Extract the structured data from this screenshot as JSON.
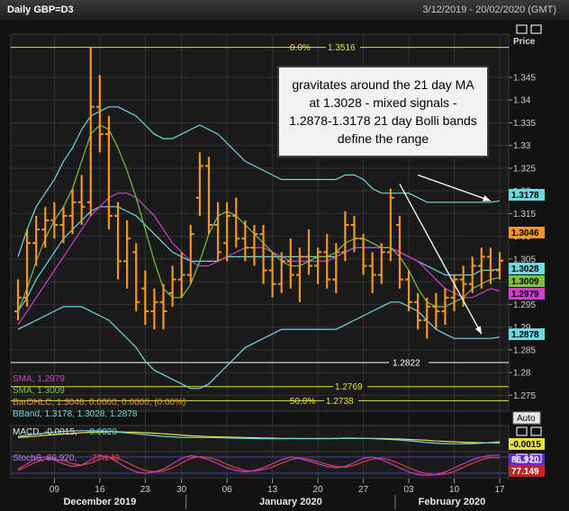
{
  "window": {
    "title": "Daily GBP=D3",
    "date_range": "3/12/2019 - 20/02/2020 (GMT)",
    "price_label": "Price",
    "auto_button": "Auto"
  },
  "annotation": {
    "text": "gravitates around the 21 day MA at 1.3028 - mixed signals - 1.2878-1.3178 21 day Bolli bands define the range"
  },
  "colors": {
    "price_bar": "#f0962a",
    "sma_magenta": "#d040d0",
    "sma_green": "#80c040",
    "bband": "#70d8e0",
    "fib_line": "#e8e040",
    "macd_line": "#70d8e0",
    "macd_signal": "#e8e040",
    "stoch_k": "#c040c0",
    "stoch_d": "#e04040",
    "grid": "#333333"
  },
  "chart_data": {
    "type": "ohlc",
    "y_axis_ticks": [
      1.275,
      1.28,
      1.285,
      1.29,
      1.295,
      1.3,
      1.305,
      1.31,
      1.315,
      1.32,
      1.325,
      1.33,
      1.335,
      1.34,
      1.345
    ],
    "ylim": [
      1.2715,
      1.3545
    ],
    "x_ticks": [
      "09",
      "16",
      "23",
      "30",
      "06",
      "13",
      "20",
      "27",
      "03",
      "10",
      "17"
    ],
    "x_tick_index": [
      4,
      9,
      14,
      18,
      23,
      28,
      33,
      38,
      43,
      48,
      53
    ],
    "months": [
      {
        "label": "December 2019",
        "start": 0,
        "end": 19
      },
      {
        "label": "January 2020",
        "start": 19,
        "end": 42
      },
      {
        "label": "February 2020",
        "start": 42,
        "end": 54
      }
    ],
    "bars": [
      [
        1.2935,
        1.3005,
        1.2915,
        1.2965
      ],
      [
        1.2965,
        1.3115,
        1.2945,
        1.3085
      ],
      [
        1.3085,
        1.3145,
        1.3035,
        1.3115
      ],
      [
        1.3115,
        1.3165,
        1.3075,
        1.3135
      ],
      [
        1.3135,
        1.3175,
        1.3095,
        1.3125
      ],
      [
        1.3125,
        1.3165,
        1.3085,
        1.3145
      ],
      [
        1.3145,
        1.3205,
        1.3105,
        1.3175
      ],
      [
        1.3175,
        1.3235,
        1.3125,
        1.3165
      ],
      [
        1.3175,
        1.3515,
        1.3145,
        1.3385
      ],
      [
        1.3385,
        1.3455,
        1.3285,
        1.3325
      ],
      [
        1.3325,
        1.3365,
        1.3115,
        1.3145
      ],
      [
        1.3145,
        1.3175,
        1.3005,
        1.3045
      ],
      [
        1.3045,
        1.3135,
        1.2985,
        1.3095
      ],
      [
        1.3065,
        1.3085,
        1.2935,
        1.2955
      ],
      [
        1.2985,
        1.3025,
        1.2905,
        1.2935
      ],
      [
        1.2935,
        1.2985,
        1.2895,
        1.2955
      ],
      [
        1.2955,
        1.2995,
        1.2895,
        1.2935
      ],
      [
        1.2975,
        1.3035,
        1.2945,
        1.3005
      ],
      [
        1.3005,
        1.3065,
        1.2965,
        1.3015
      ],
      [
        1.3015,
        1.3125,
        1.2995,
        1.3105
      ],
      [
        1.3185,
        1.3285,
        1.3145,
        1.3255
      ],
      [
        1.3255,
        1.3275,
        1.3105,
        1.3125
      ],
      [
        1.3125,
        1.3175,
        1.3045,
        1.3065
      ],
      [
        1.3085,
        1.3175,
        1.3045,
        1.3145
      ],
      [
        1.3145,
        1.3185,
        1.3075,
        1.3095
      ],
      [
        1.3095,
        1.3135,
        1.3045,
        1.3075
      ],
      [
        1.3075,
        1.3125,
        1.3035,
        1.3105
      ],
      [
        1.3105,
        1.3125,
        1.2995,
        1.3025
      ],
      [
        1.3025,
        1.3065,
        1.2965,
        1.2995
      ],
      [
        1.2995,
        1.3065,
        1.2975,
        1.3045
      ],
      [
        1.3045,
        1.3095,
        1.2985,
        1.3015
      ],
      [
        1.3015,
        1.3075,
        1.2955,
        1.3055
      ],
      [
        1.3055,
        1.3115,
        1.3015,
        1.3035
      ],
      [
        1.3035,
        1.3075,
        1.2995,
        1.3065
      ],
      [
        1.3065,
        1.3105,
        1.2985,
        1.3005
      ],
      [
        1.3005,
        1.3085,
        1.2975,
        1.3065
      ],
      [
        1.3065,
        1.3155,
        1.3045,
        1.3125
      ],
      [
        1.3125,
        1.3145,
        1.3065,
        1.3095
      ],
      [
        1.3095,
        1.3105,
        1.3015,
        1.3035
      ],
      [
        1.3035,
        1.3065,
        1.2975,
        1.3015
      ],
      [
        1.3015,
        1.3085,
        1.2995,
        1.3065
      ],
      [
        1.3065,
        1.3205,
        1.3045,
        1.3185
      ],
      [
        1.3125,
        1.3145,
        1.2985,
        1.3005
      ],
      [
        1.3005,
        1.3025,
        1.2935,
        1.2955
      ],
      [
        1.2955,
        1.2975,
        1.2895,
        1.2915
      ],
      [
        1.2915,
        1.2965,
        1.2875,
        1.2945
      ],
      [
        1.2945,
        1.2975,
        1.2895,
        1.2935
      ],
      [
        1.2935,
        1.2985,
        1.2905,
        1.2965
      ],
      [
        1.2965,
        1.3015,
        1.2935,
        1.3005
      ],
      [
        1.3005,
        1.3035,
        1.2945,
        1.2995
      ],
      [
        1.2995,
        1.3055,
        1.2975,
        1.3035
      ],
      [
        1.3035,
        1.3075,
        1.2985,
        1.3055
      ],
      [
        1.3055,
        1.3075,
        1.2995,
        1.3025
      ],
      [
        1.3025,
        1.3065,
        1.3005,
        1.3046
      ]
    ],
    "sma_magenta": [
      1.2905,
      1.2935,
      1.2965,
      1.2995,
      1.3025,
      1.3055,
      1.3085,
      1.3115,
      1.3145,
      1.3165,
      1.3185,
      1.3195,
      1.3195,
      1.3185,
      1.3165,
      1.3145,
      1.3115,
      1.3085,
      1.3065,
      1.3045,
      1.3035,
      1.3035,
      1.3045,
      1.3055,
      1.3065,
      1.3075,
      1.3075,
      1.3075,
      1.3065,
      1.3055,
      1.3045,
      1.3045,
      1.3045,
      1.3045,
      1.3045,
      1.3055,
      1.3065,
      1.3075,
      1.3075,
      1.3075,
      1.3075,
      1.3075,
      1.3065,
      1.3055,
      1.3045,
      1.3025,
      1.3005,
      1.2985,
      1.2975,
      1.2965,
      1.2965,
      1.2975,
      1.2985,
      1.2979
    ],
    "sma_green": [
      1.2935,
      1.2985,
      1.3045,
      1.3095,
      1.3135,
      1.3165,
      1.3205,
      1.3265,
      1.3325,
      1.3345,
      1.3335,
      1.3295,
      1.3245,
      1.3185,
      1.3115,
      1.3045,
      1.2985,
      1.2965,
      1.2965,
      1.2995,
      1.3045,
      1.3105,
      1.3145,
      1.3155,
      1.3145,
      1.3125,
      1.3105,
      1.3085,
      1.3065,
      1.3045,
      1.3035,
      1.3035,
      1.3045,
      1.3055,
      1.3055,
      1.3065,
      1.3085,
      1.3095,
      1.3095,
      1.3085,
      1.3075,
      1.3075,
      1.3055,
      1.3025,
      1.2985,
      1.2955,
      1.2945,
      1.2945,
      1.2955,
      1.2965,
      1.2985,
      1.2995,
      1.3005,
      1.3009
    ],
    "bb_upper": [
      1.3055,
      1.3115,
      1.3165,
      1.3195,
      1.3225,
      1.3265,
      1.3295,
      1.3335,
      1.3365,
      1.3375,
      1.3385,
      1.3385,
      1.3375,
      1.3365,
      1.3345,
      1.3325,
      1.3315,
      1.3315,
      1.3325,
      1.3335,
      1.3345,
      1.3335,
      1.3325,
      1.3305,
      1.3285,
      1.3265,
      1.3255,
      1.3245,
      1.3235,
      1.3225,
      1.3225,
      1.3225,
      1.3225,
      1.3225,
      1.3225,
      1.3225,
      1.3235,
      1.3235,
      1.3225,
      1.3205,
      1.3195,
      1.3195,
      1.3195,
      1.3195,
      1.3185,
      1.3175,
      1.3175,
      1.3175,
      1.3175,
      1.3175,
      1.3175,
      1.3175,
      1.3175,
      1.3178
    ],
    "bb_mid": [
      1.2935,
      1.2965,
      1.3005,
      1.3035,
      1.3065,
      1.3095,
      1.3115,
      1.3135,
      1.3155,
      1.3165,
      1.3165,
      1.3165,
      1.3155,
      1.3145,
      1.3125,
      1.3105,
      1.3085,
      1.3065,
      1.3055,
      1.3045,
      1.3045,
      1.3045,
      1.3045,
      1.3055,
      1.3055,
      1.3055,
      1.3055,
      1.3055,
      1.3055,
      1.3055,
      1.3055,
      1.3055,
      1.3055,
      1.3055,
      1.3055,
      1.3055,
      1.3065,
      1.3075,
      1.3075,
      1.3075,
      1.3075,
      1.3075,
      1.3065,
      1.3055,
      1.3045,
      1.3035,
      1.3025,
      1.3015,
      1.3015,
      1.3015,
      1.3015,
      1.3025,
      1.3025,
      1.3028
    ],
    "bb_lower": [
      1.2895,
      1.2905,
      1.2915,
      1.2925,
      1.2935,
      1.2945,
      1.2945,
      1.2945,
      1.2935,
      1.2925,
      1.2915,
      1.2895,
      1.2875,
      1.2855,
      1.2825,
      1.2805,
      1.2795,
      1.2785,
      1.2775,
      1.2765,
      1.2765,
      1.2775,
      1.2795,
      1.2815,
      1.2835,
      1.2855,
      1.2865,
      1.2875,
      1.2885,
      1.2895,
      1.2895,
      1.2895,
      1.2895,
      1.2895,
      1.2895,
      1.2895,
      1.2905,
      1.2915,
      1.2925,
      1.2935,
      1.2945,
      1.2955,
      1.2955,
      1.2945,
      1.2935,
      1.2915,
      1.2895,
      1.2885,
      1.2875,
      1.2875,
      1.2875,
      1.2875,
      1.2875,
      1.2878
    ],
    "fib_lines": [
      {
        "value": 1.3516,
        "label": "0.0%",
        "value_text": "1.3516"
      },
      {
        "value": 1.2769,
        "label": "",
        "value_text": "1.2769"
      },
      {
        "value": 1.2738,
        "label": "50.0%",
        "value_text": "1.2738"
      }
    ],
    "level_lines": [
      {
        "value": 1.2822,
        "value_text": "1.2822"
      }
    ],
    "price_tags": [
      {
        "value": 1.3178,
        "text": "1.3178",
        "color": "#70d8e0"
      },
      {
        "value": 1.3046,
        "text": "1.3046",
        "color": "#f0962a"
      },
      {
        "value": 1.3028,
        "text": "1.3028",
        "color": "#70d8e0"
      },
      {
        "value": 1.3009,
        "text": "1.3009",
        "color": "#80c040"
      },
      {
        "value": 1.2979,
        "text": "1.2979",
        "color": "#d040d0"
      },
      {
        "value": 1.2878,
        "text": "1.2878",
        "color": "#70d8e0"
      }
    ],
    "arrows": [
      {
        "from": [
          44,
          1.3235
        ],
        "to": [
          52,
          1.3178
        ]
      },
      {
        "from": [
          42,
          1.3215
        ],
        "to": [
          51,
          1.2885
        ]
      }
    ],
    "legend": [
      {
        "text": "SMA, 1.2979",
        "color": "#d040d0"
      },
      {
        "text": "SMA, 1.3009",
        "color": "#80c040"
      },
      {
        "text": "BarOHLC, 1.3046, 0.0000, 0.0000, (0.00%)",
        "color": "#f0962a"
      },
      {
        "text": "BBand, 1.3178, 1.3028, 1.2878",
        "color": "#70d8e0"
      }
    ],
    "macd": {
      "legend_name": "MACD, -0.0015, ",
      "legend_value": "-0.0020",
      "last": -0.0015,
      "last_text": "-0.0015",
      "ylim": [
        -0.006,
        0.006
      ],
      "macd": [
        0.001,
        0.0015,
        0.002,
        0.0025,
        0.003,
        0.0033,
        0.0035,
        0.0036,
        0.0036,
        0.0035,
        0.0033,
        0.003,
        0.0026,
        0.0022,
        0.0018,
        0.0014,
        0.001,
        0.0008,
        0.0006,
        0.0005,
        0.0005,
        0.0005,
        0.0004,
        0.0003,
        0.0002,
        0.0001,
        0,
        -0.0001,
        -0.0001,
        -0.0001,
        0,
        0,
        0,
        0,
        0,
        0.0001,
        0.0002,
        0.0002,
        0.0001,
        0,
        -0.0002,
        -0.0004,
        -0.0007,
        -0.001,
        -0.0014,
        -0.0018,
        -0.0021,
        -0.0023,
        -0.0024,
        -0.0024,
        -0.0023,
        -0.0021,
        -0.0018,
        -0.0015
      ],
      "signal": [
        0.0005,
        0.0008,
        0.0011,
        0.0015,
        0.0018,
        0.0021,
        0.0024,
        0.0027,
        0.0029,
        0.003,
        0.0031,
        0.0031,
        0.003,
        0.0029,
        0.0027,
        0.0025,
        0.0022,
        0.0019,
        0.0016,
        0.0013,
        0.0011,
        0.0009,
        0.0008,
        0.0007,
        0.0006,
        0.0005,
        0.0004,
        0.0003,
        0.0002,
        0.0001,
        0.0001,
        0,
        0,
        0,
        0,
        0,
        0.0001,
        0.0001,
        0.0001,
        0.0001,
        0,
        -0.0001,
        -0.0002,
        -0.0004,
        -0.0006,
        -0.0008,
        -0.0011,
        -0.0013,
        -0.0015,
        -0.0017,
        -0.0018,
        -0.0019,
        -0.002,
        -0.002
      ]
    },
    "stoch": {
      "legend_name": "StochS, 86.920, ",
      "legend_value": "77.149",
      "k_text": "86.920",
      "d_text": "77.149",
      "k": [
        35,
        55,
        75,
        80,
        70,
        55,
        45,
        50,
        70,
        85,
        80,
        60,
        40,
        25,
        20,
        25,
        35,
        55,
        75,
        85,
        80,
        70,
        55,
        40,
        30,
        25,
        30,
        40,
        55,
        70,
        80,
        75,
        65,
        55,
        45,
        40,
        45,
        60,
        75,
        80,
        70,
        55,
        40,
        25,
        15,
        12,
        15,
        25,
        40,
        55,
        70,
        80,
        86,
        86.92
      ],
      "d": [
        30,
        45,
        62,
        72,
        74,
        66,
        55,
        50,
        58,
        72,
        80,
        75,
        60,
        43,
        30,
        25,
        28,
        40,
        58,
        75,
        82,
        78,
        68,
        53,
        40,
        30,
        28,
        33,
        43,
        57,
        70,
        76,
        72,
        63,
        53,
        45,
        42,
        50,
        62,
        73,
        76,
        68,
        55,
        40,
        27,
        18,
        14,
        17,
        27,
        42,
        57,
        70,
        78,
        77.149
      ]
    }
  }
}
